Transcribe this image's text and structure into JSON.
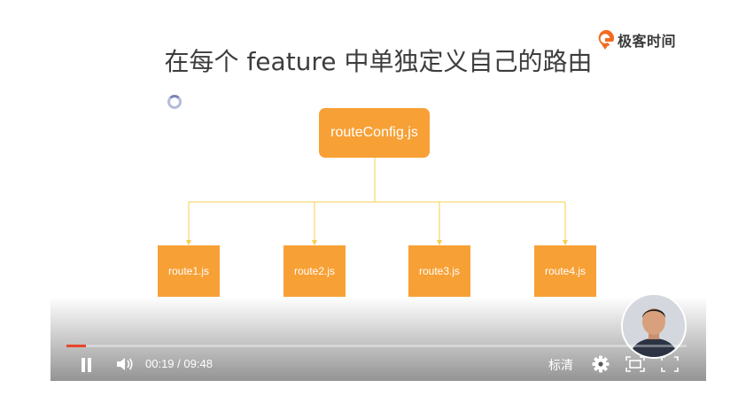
{
  "brand": {
    "name": "极客时间",
    "color": "#f26a21"
  },
  "slide": {
    "title": "在每个 feature 中单独定义自己的路由",
    "root_node": "routeConfig.js",
    "leaf_nodes": [
      "route1.js",
      "route2.js",
      "route3.js",
      "route4.js"
    ],
    "node_color": "#f7a035",
    "connector_color": "#f5d04a"
  },
  "player": {
    "progress": 0.032,
    "current_time": "00:19",
    "separator": "/",
    "duration": "09:48",
    "quality_label": "标清",
    "accent_color": "#e8462c"
  },
  "icons": {
    "play_state": "pause-icon",
    "volume": "volume-icon",
    "settings": "gear-icon",
    "pip": "picture-in-picture-icon",
    "fullscreen": "fullscreen-icon",
    "loading": "loading-spinner-icon"
  }
}
